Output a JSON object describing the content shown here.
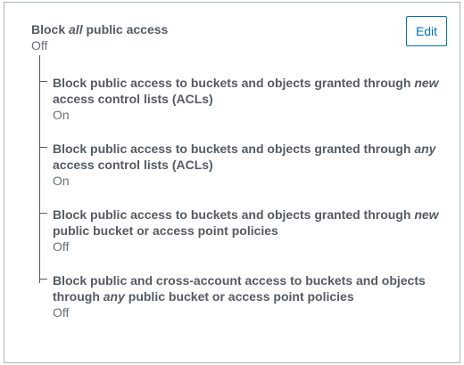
{
  "main": {
    "title_pre": "Block ",
    "title_em": "all",
    "title_post": " public access",
    "status": "Off",
    "edit_label": "Edit"
  },
  "settings": [
    {
      "line1_pre": "Block public access to buckets and objects granted through ",
      "line1_em": "new",
      "line2_pre": "access control lists (ACLs)",
      "line2_em": "",
      "line2_post": "",
      "status": "On"
    },
    {
      "line1_pre": "Block public access to buckets and objects granted through ",
      "line1_em": "any",
      "line2_pre": "access control lists (ACLs)",
      "line2_em": "",
      "line2_post": "",
      "status": "On"
    },
    {
      "line1_pre": "Block public access to buckets and objects granted through ",
      "line1_em": "new",
      "line2_pre": "public bucket or access point policies",
      "line2_em": "",
      "line2_post": "",
      "status": "Off"
    },
    {
      "line1_pre": "Block public and cross-account access to buckets and objects",
      "line1_em": "",
      "line2_pre": "through ",
      "line2_em": "any",
      "line2_post": " public bucket or access point policies",
      "status": "Off"
    }
  ],
  "colors": {
    "text_heading": "#545b64",
    "text_status": "#687078",
    "accent": "#0073bb",
    "border": "#aab7b8"
  }
}
